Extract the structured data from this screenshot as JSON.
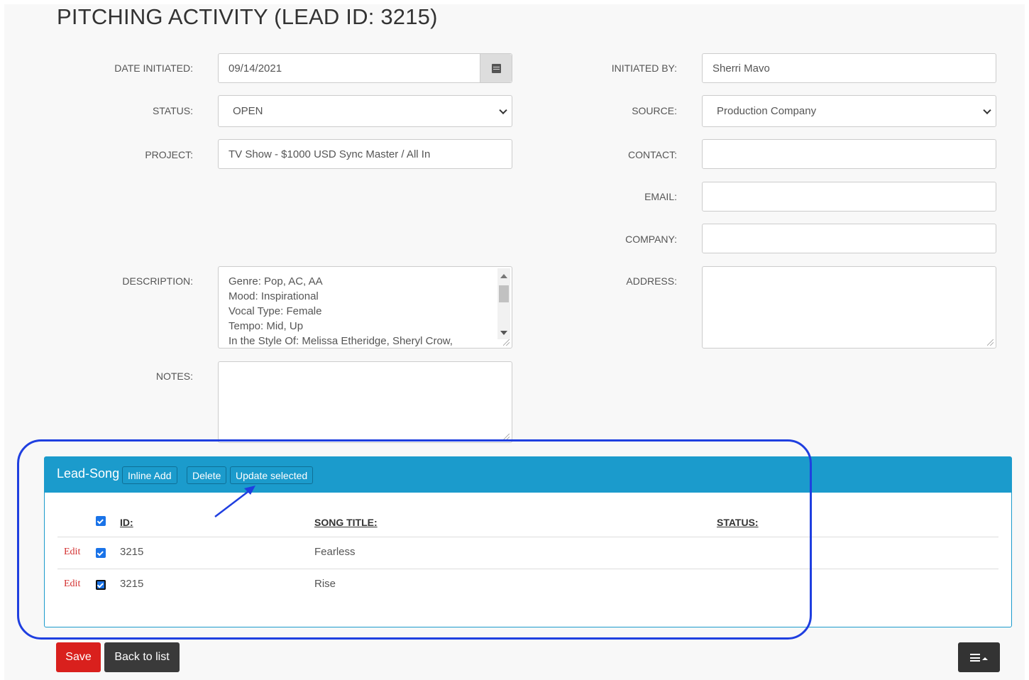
{
  "page": {
    "title": "PITCHING ACTIVITY (LEAD ID: 3215)"
  },
  "form": {
    "date_initiated": {
      "label": "DATE INITIATED:",
      "value": "09/14/2021",
      "icon": "calendar-icon"
    },
    "status": {
      "label": "STATUS:",
      "value": "OPEN"
    },
    "project": {
      "label": "PROJECT:",
      "value": "TV Show - $1000 USD Sync Master / All In"
    },
    "description": {
      "label": "DESCRIPTION:",
      "lines": [
        "Genre: Pop, AC, AA",
        "Mood: Inspirational",
        "Vocal Type: Female",
        "Tempo: Mid, Up",
        "In the Style Of: Melissa Etheridge, Sheryl Crow,"
      ]
    },
    "notes": {
      "label": "NOTES:",
      "value": ""
    },
    "initiated_by": {
      "label": "INITIATED BY:",
      "value": "Sherri Mavo"
    },
    "source": {
      "label": "SOURCE:",
      "value": "Production Company"
    },
    "contact": {
      "label": "CONTACT:",
      "value": ""
    },
    "email": {
      "label": "EMAIL:",
      "value": ""
    },
    "company": {
      "label": "COMPANY:",
      "value": ""
    },
    "address": {
      "label": "ADDRESS:",
      "value": ""
    }
  },
  "lead_song": {
    "title": "Lead-Song",
    "buttons": {
      "inline_add": "Inline Add",
      "delete": "Delete",
      "update_selected": "Update selected"
    },
    "columns": {
      "id": "ID:",
      "song_title": "SONG TITLE:",
      "status": "STATUS:"
    },
    "rows": [
      {
        "edit": "Edit",
        "id": "3215",
        "song_title": "Fearless",
        "status": ""
      },
      {
        "edit": "Edit",
        "id": "3215",
        "song_title": "Rise",
        "status": ""
      }
    ]
  },
  "footer": {
    "save": "Save",
    "back": "Back to list"
  },
  "colors": {
    "panel_header": "#1b9bcc",
    "save_button": "#d9201d",
    "annotation": "#1f3fe0",
    "edit_link": "#d32f2f"
  }
}
